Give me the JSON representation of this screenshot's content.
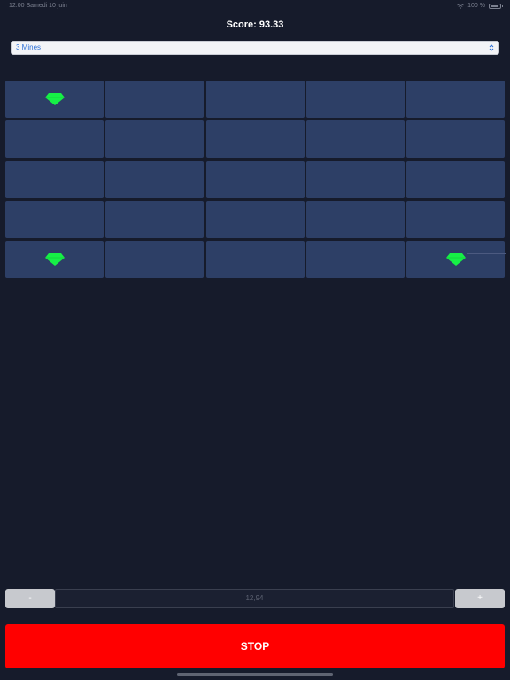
{
  "status_bar": {
    "left_text": "12:00  Samedi 10 juin",
    "battery_text": "100 %",
    "icons": [
      "wifi-icon",
      "battery-icon"
    ]
  },
  "score": {
    "label": "Score: 93.33"
  },
  "mines_select": {
    "value": "3 Mines",
    "icon": "chevron-updown-icon"
  },
  "grid": {
    "rows": 5,
    "columns": 5,
    "tiles": [
      {
        "gem": true
      },
      {
        "gem": false
      },
      {
        "gem": false
      },
      {
        "gem": false
      },
      {
        "gem": false
      },
      {
        "gem": false
      },
      {
        "gem": false
      },
      {
        "gem": false
      },
      {
        "gem": false
      },
      {
        "gem": false
      },
      {
        "gem": false
      },
      {
        "gem": false
      },
      {
        "gem": false
      },
      {
        "gem": false
      },
      {
        "gem": false
      },
      {
        "gem": false
      },
      {
        "gem": false
      },
      {
        "gem": false
      },
      {
        "gem": false
      },
      {
        "gem": false
      },
      {
        "gem": true
      },
      {
        "gem": false
      },
      {
        "gem": false
      },
      {
        "gem": false
      },
      {
        "gem": true
      }
    ],
    "gem_color": "#16f046",
    "tile_color": "#2d3f66"
  },
  "bet": {
    "minus_label": "-",
    "value": "12,94",
    "plus_label": "+"
  },
  "stop_button": {
    "label": "STOP",
    "color": "#ff0000"
  }
}
